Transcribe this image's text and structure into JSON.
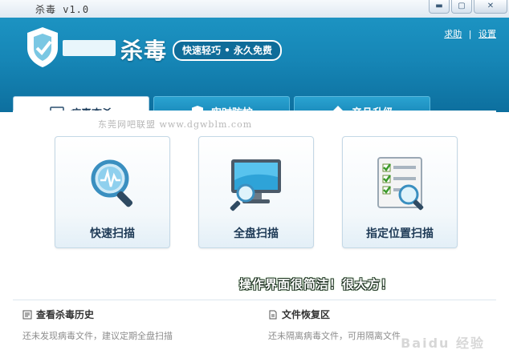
{
  "window": {
    "title": "杀毒 v1.0",
    "controls": [
      "minimize",
      "maximize",
      "close"
    ]
  },
  "header": {
    "brand_name": "杀毒",
    "slogan": "快速轻巧 • 永久免费",
    "links": {
      "help": "求助",
      "settings": "设置"
    }
  },
  "tabs": [
    {
      "label": "病毒查杀",
      "icon": "monitor-icon",
      "active": true
    },
    {
      "label": "实时防护",
      "icon": "shield-icon",
      "active": false
    },
    {
      "label": "产品升级",
      "icon": "upgrade-arrow-icon",
      "active": false
    }
  ],
  "watermark": "东莞网吧联盟 www.dgwblm.com",
  "scan_options": [
    {
      "label": "快速扫描",
      "icon": "magnifier-icon"
    },
    {
      "label": "全盘扫描",
      "icon": "monitor-magnifier-icon"
    },
    {
      "label": "指定位置扫描",
      "icon": "checklist-magnifier-icon"
    }
  ],
  "promo_text": "操作界面很简洁！很大方！",
  "bottom_info": {
    "history": {
      "title": "查看杀毒历史",
      "desc": "还未发现病毒文件，建议定期全盘扫描"
    },
    "recovery": {
      "title": "文件恢复区",
      "desc": "还未隔离病毒文件，可用隔离文件"
    }
  },
  "corner_watermark": "Baidu 经验",
  "colors": {
    "header": "#1686b6",
    "tab": "#0f79ab",
    "text_dark": "#1f3b57"
  }
}
